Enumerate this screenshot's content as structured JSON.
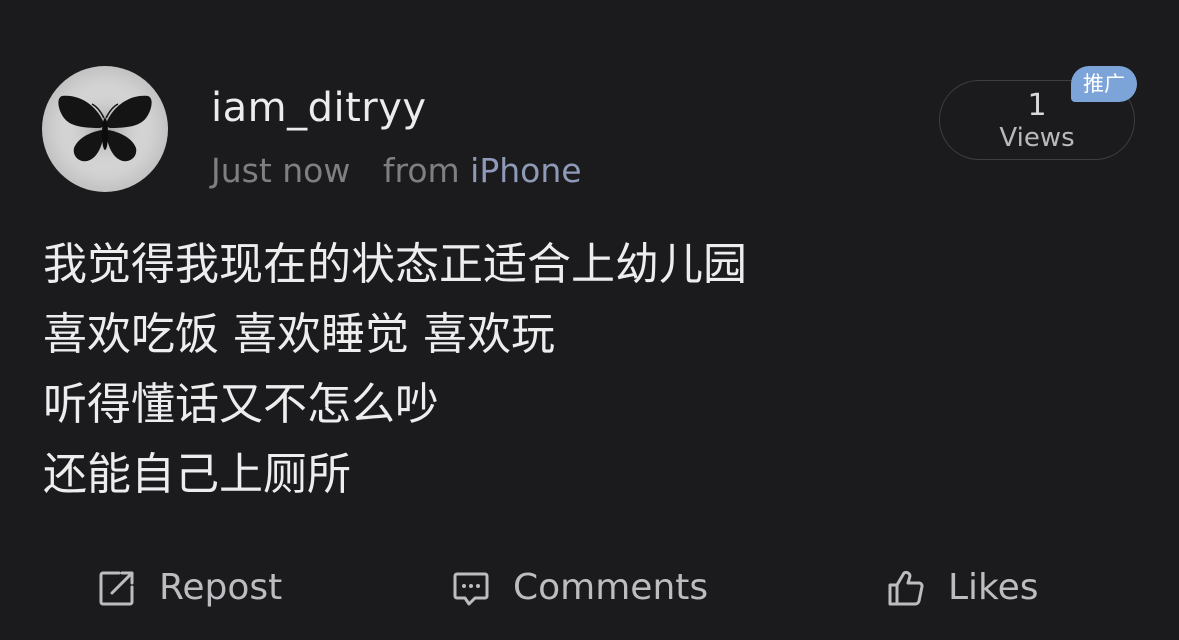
{
  "post": {
    "username": "iam_ditryy",
    "time": "Just now",
    "source_prefix": "from",
    "source_device": "iPhone",
    "avatar_icon": "butterfly-icon",
    "views": {
      "count": "1",
      "label": "Views"
    },
    "promo_badge": "推广",
    "content_lines": [
      "我觉得我现在的状态正适合上幼儿园",
      "喜欢吃饭 喜欢睡觉 喜欢玩",
      "听得懂话又不怎么吵",
      "还能自己上厕所"
    ]
  },
  "actions": {
    "repost": {
      "label": "Repost",
      "icon": "repost-icon"
    },
    "comments": {
      "label": "Comments",
      "icon": "comment-icon"
    },
    "likes": {
      "label": "Likes",
      "icon": "thumbs-up-icon"
    }
  },
  "colors": {
    "background": "#1b1b1d",
    "primary_text": "#ececec",
    "secondary_text": "#7f7f83",
    "device_link": "#8f9ab8",
    "badge": "#7da4d8"
  }
}
